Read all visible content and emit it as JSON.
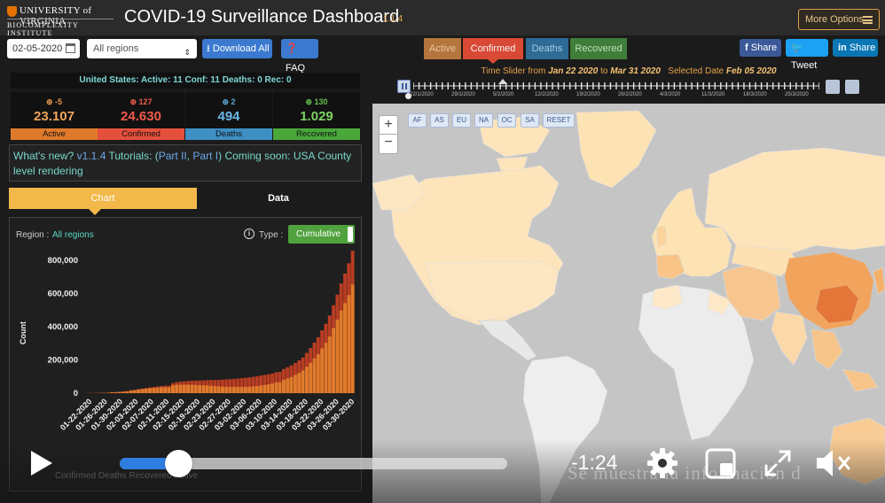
{
  "header": {
    "logo_line1": "UNIVERSITY of VIRGINIA",
    "logo_line2": "BIOCOMPLEXITY INSTITUTE",
    "title": "COVID-19 Surveillance Dashboard",
    "version": "1.1.4",
    "more_options_label": "More Options"
  },
  "toolbar": {
    "date_value": "02-05-2020",
    "region_value": "All regions",
    "download_label": "Download All",
    "faq_label": "FAQ",
    "metric_tabs": [
      "Active",
      "Confirmed",
      "Deaths",
      "Recovered"
    ],
    "selected_metric": "Confirmed",
    "share_facebook": "Share",
    "share_twitter": "Tweet",
    "share_linkedin": "Share"
  },
  "summary": {
    "banner": "United States: Active: 11 Conf: 11 Deaths: 0 Rec: 0",
    "cards": [
      {
        "delta": "-5",
        "value": "23.107",
        "label": "Active"
      },
      {
        "delta": "127",
        "value": "24.630",
        "label": "Confirmed"
      },
      {
        "delta": "2",
        "value": "494",
        "label": "Deaths"
      },
      {
        "delta": "130",
        "value": "1.029",
        "label": "Recovered"
      }
    ]
  },
  "whats_new": {
    "prefix": "What's new?",
    "version_link": "v1.1.4",
    "tutorials_label": "Tutorials: (",
    "part2_link": "Part II",
    "sep": ", ",
    "part1_link": "Part I",
    "suffix": ") Coming soon: USA County level rendering"
  },
  "panel_tabs": {
    "chart": "Chart",
    "data": "Data"
  },
  "chart_controls": {
    "region_label": "Region :",
    "region_value": "All regions",
    "info_icon": "i",
    "type_label": "Type :",
    "type_value": "Cumulative"
  },
  "timeline": {
    "prefix": "Time Slider from",
    "start": "Jan 22 2020",
    "to": "to",
    "end": "Mar 31 2020",
    "selected_prefix": "Selected Date",
    "selected": "Feb 05 2020",
    "tick_labels": [
      "22/1/2020",
      "29/1/2020",
      "5/2/2020",
      "12/2/2020",
      "19/2/2020",
      "26/2/2020",
      "4/3/2020",
      "11/3/2020",
      "18/3/2020",
      "25/3/2020"
    ]
  },
  "map": {
    "zoom_in": "+",
    "zoom_out": "−",
    "region_buttons": [
      "AF",
      "AS",
      "EU",
      "NA",
      "OC",
      "SA",
      "RESET"
    ]
  },
  "video": {
    "time_remaining": "-1:24",
    "progress": 0.15,
    "subtitle_ghost": "Se muestra la información d",
    "legend_ghost": "Confirmed      Deaths      Recovered      Active"
  },
  "colors": {
    "active": "#e07a2b",
    "confirmed": "#e5503c",
    "deaths": "#3e8fc4",
    "recovered": "#4aa83a",
    "accent": "#f2b84a"
  },
  "chart_data": {
    "type": "bar",
    "title": "",
    "ylabel": "Count",
    "xlabel": "",
    "ylim": [
      0,
      800000
    ],
    "yticks": [
      "0",
      "200,000",
      "400,000",
      "600,000",
      "800,000"
    ],
    "x_labels": [
      "01-22-2020",
      "01-26-2020",
      "01-30-2020",
      "02-03-2020",
      "02-07-2020",
      "02-11-2020",
      "02-15-2020",
      "02-19-2020",
      "02-23-2020",
      "02-27-2020",
      "03-02-2020",
      "03-06-2020",
      "03-10-2020",
      "03-14-2020",
      "03-18-2020",
      "03-22-2020",
      "03-26-2020",
      "03-30-2020"
    ],
    "series": [
      {
        "name": "Confirmed",
        "values": [
          555,
          654,
          941,
          1434,
          2118,
          2927,
          5578,
          6166,
          8234,
          9927,
          12038,
          16787,
          19881,
          23892,
          27635,
          30794,
          34391,
          37120,
          40150,
          42762,
          44802,
          45221,
          60368,
          66885,
          69030,
          71224,
          73258,
          75136,
          75639,
          76197,
          76819,
          78572,
          78958,
          79561,
          80406,
          81388,
          82746,
          84112,
          86011,
          88369,
          90306,
          92840,
          95120,
          97886,
          101801,
          105847,
          109821,
          113590,
          118620,
          125875,
          128352,
          145205,
          156101,
          167454,
          181574,
          197102,
          214821,
          242570,
          272208,
          304507,
          336953,
          378235,
          418045,
          467653,
          529591,
          593291,
          660693,
          720140,
          782389,
          857487
        ]
      },
      {
        "name": "Active",
        "values": [
          510,
          605,
          880,
          1350,
          2000,
          2770,
          5310,
          5800,
          7800,
          9300,
          11200,
          15600,
          18300,
          21800,
          24900,
          27400,
          30100,
          31800,
          33800,
          34900,
          35700,
          35100,
          46500,
          50400,
          50700,
          50800,
          50600,
          50300,
          49600,
          48300,
          46800,
          46400,
          44300,
          42500,
          40600,
          39300,
          38900,
          38300,
          38400,
          38200,
          37900,
          38400,
          39000,
          40300,
          43000,
          46400,
          49800,
          53500,
          58100,
          64700,
          66400,
          80500,
          88800,
          97600,
          109300,
          121500,
          136400,
          158900,
          182800,
          209200,
          234900,
          270500,
          303400,
          340900,
          392600,
          443300,
          498300,
          542400,
          590500,
          655000
        ]
      }
    ]
  }
}
